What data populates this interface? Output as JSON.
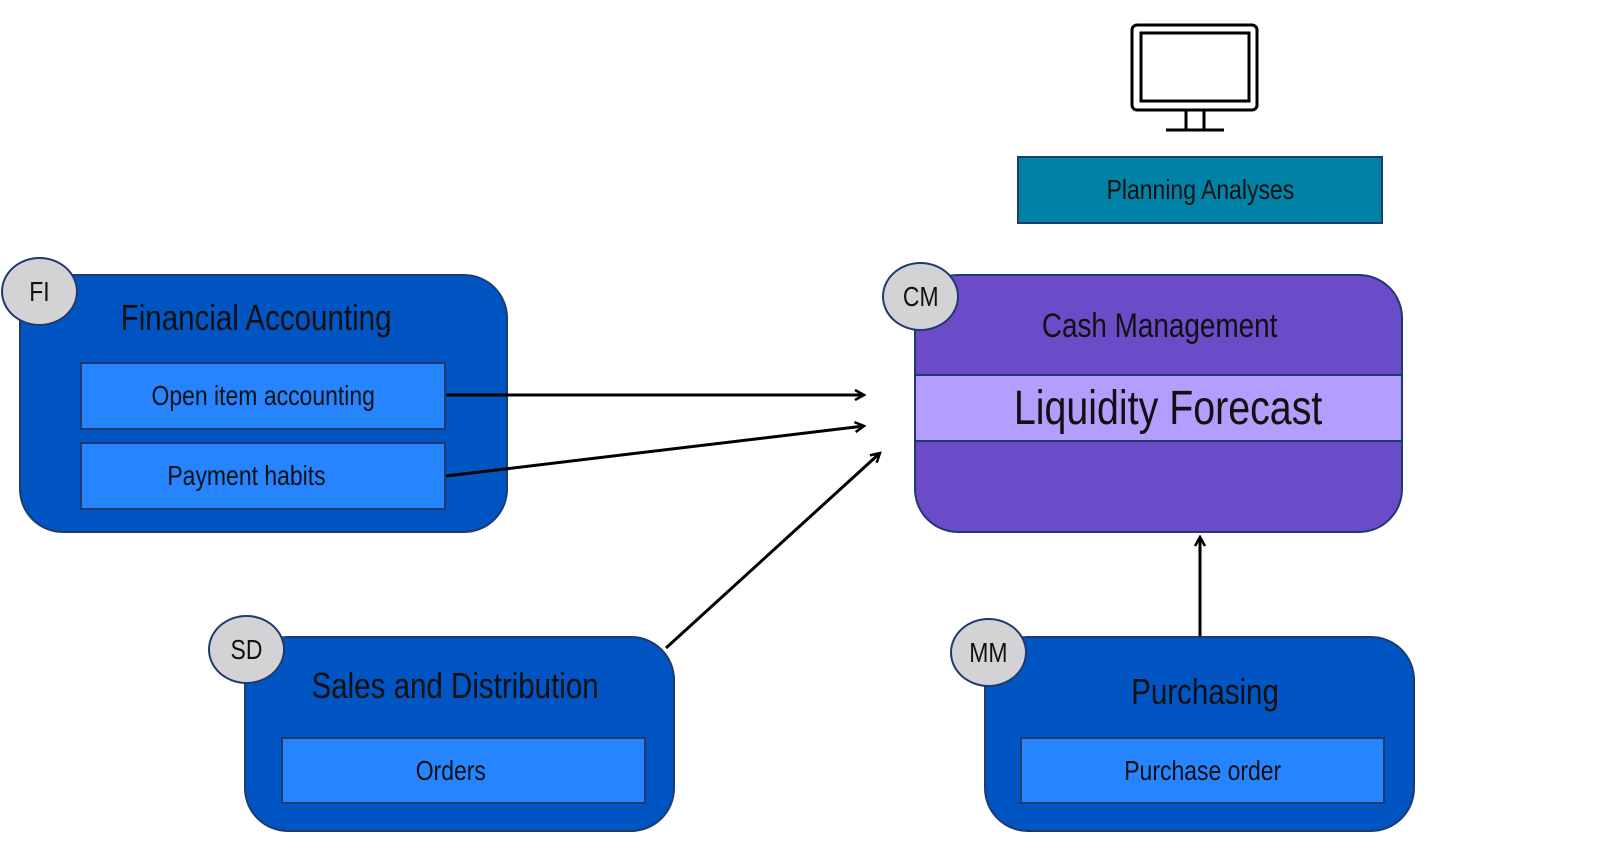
{
  "colors": {
    "module_blue": "#0055c3",
    "sub_blue": "#2684ff",
    "cash_purple": "#6b4bc8",
    "forecast_band": "#b39dfd",
    "planning_teal": "#0081a6",
    "badge_gray": "#d3d3d6"
  },
  "monitor": {
    "icon": "monitor-icon"
  },
  "planning": {
    "label": "Planning Analyses"
  },
  "fi": {
    "badge": "FI",
    "title": "Financial Accounting",
    "items": [
      "Open item accounting",
      "Payment habits"
    ]
  },
  "cm": {
    "badge": "CM",
    "title": "Cash Management",
    "band": "Liquidity Forecast"
  },
  "sd": {
    "badge": "SD",
    "title": "Sales and Distribution",
    "items": [
      "Orders"
    ]
  },
  "mm": {
    "badge": "MM",
    "title": "Purchasing",
    "items": [
      "Purchase order"
    ]
  }
}
